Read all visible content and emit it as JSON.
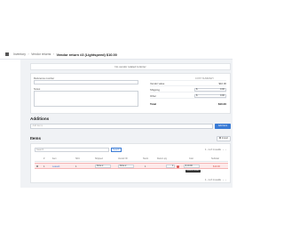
{
  "breadcrumb": {
    "items": [
      "Inventory",
      "Vendor returns"
    ],
    "current": "Vendor return #3 (Lightspeed) $10.00"
  },
  "notice": "No vendor related to Enter",
  "form": {
    "reference_label": "Reference number",
    "notes_label": "Notes"
  },
  "summary": {
    "header_label": "COST SUMMARY",
    "vendor_value_label": "Vendor value",
    "vendor_value": "$10.00",
    "shipping_label": "Shipping",
    "shipping_currency": "$",
    "shipping_value": "0.00",
    "other_label": "Other",
    "other_currency": "$",
    "other_value": "0.00",
    "total_label": "Total",
    "total_value": "$10.00"
  },
  "additions": {
    "title": "Additions",
    "input_placeholder": "Add items",
    "add_button": "Add item"
  },
  "items": {
    "title": "Items",
    "import_button": "Import",
    "search_placeholder": "Search",
    "search_button": "Search",
    "pager_text": "1 - 1 of 1 results",
    "pager_prev": "‹",
    "pager_next": "›",
    "columns": [
      "#",
      "Item",
      "SKU",
      "Shipped",
      "Vendor ID",
      "Stock",
      "Return qty",
      "Cost",
      "Subtotal"
    ],
    "row": {
      "index": "1",
      "item": "Leave1",
      "sku": "1",
      "shipped": "None",
      "vendor_id": "None",
      "stock": "1",
      "return_qty": "1",
      "cost": "10.00",
      "cost_currency": "$",
      "subtotal": "$10.00"
    },
    "tooltip": "Return reason",
    "pager_bottom_text": "1 - 1 of 1 results"
  }
}
